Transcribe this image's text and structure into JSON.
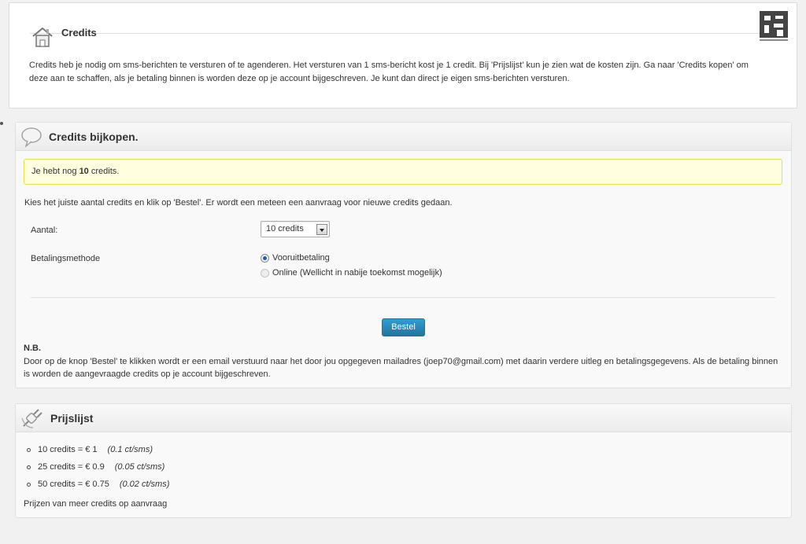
{
  "intro_box": {
    "title": "Credits",
    "text": "Credits heb je nodig om sms-berichten te versturen of te agenderen. Het versturen van 1 sms-bericht kost je 1 credit. Bij 'Prijslijst' kun je zien wat de kosten zijn. Ga naar 'Credits kopen' om deze aan te schaffen, als je betaling binnen is worden deze op je account bijgeschreven. Je kunt dan direct je eigen sms-berichten versturen."
  },
  "buy": {
    "title": "Credits bijkopen.",
    "notice_prefix": "Je hebt nog ",
    "notice_credits": "10",
    "notice_suffix": " credits.",
    "instruction": "Kies het juiste aantal credits en klik op 'Bestel'. Er wordt een meteen een aanvraag voor nieuwe credits gedaan.",
    "amount_label": "Aantal:",
    "amount_value": "10 credits",
    "payment_label": "Betalingsmethode",
    "payment_options": [
      "Vooruitbetaling",
      "Online (Wellicht in nabije toekomst mogelijk)"
    ],
    "order_button": "Bestel",
    "nb_title": "N.B.",
    "nb_text": "Door op de knop 'Bestel' te klikken wordt er een email verstuurd naar het door jou opgegeven mailadres (joep70@gmail.com) met daarin verdere uitleg en betalingsgegevens. Als de betaling binnen is worden de aangevraagde credits op je account bijgeschreven."
  },
  "prices": {
    "title": "Prijslijst",
    "items": [
      {
        "label": "10 credits = € 1",
        "note": "(0.1 ct/sms)"
      },
      {
        "label": "25 credits = € 0.9",
        "note": "(0.05 ct/sms)"
      },
      {
        "label": "50 credits = € 0.75",
        "note": "(0.02 ct/sms)"
      }
    ],
    "footer": "Prijzen van meer credits op aanvraag"
  },
  "colors": {
    "accent": "#21759b",
    "notice_bg": "#ffffe0",
    "notice_border": "#e6db55"
  }
}
